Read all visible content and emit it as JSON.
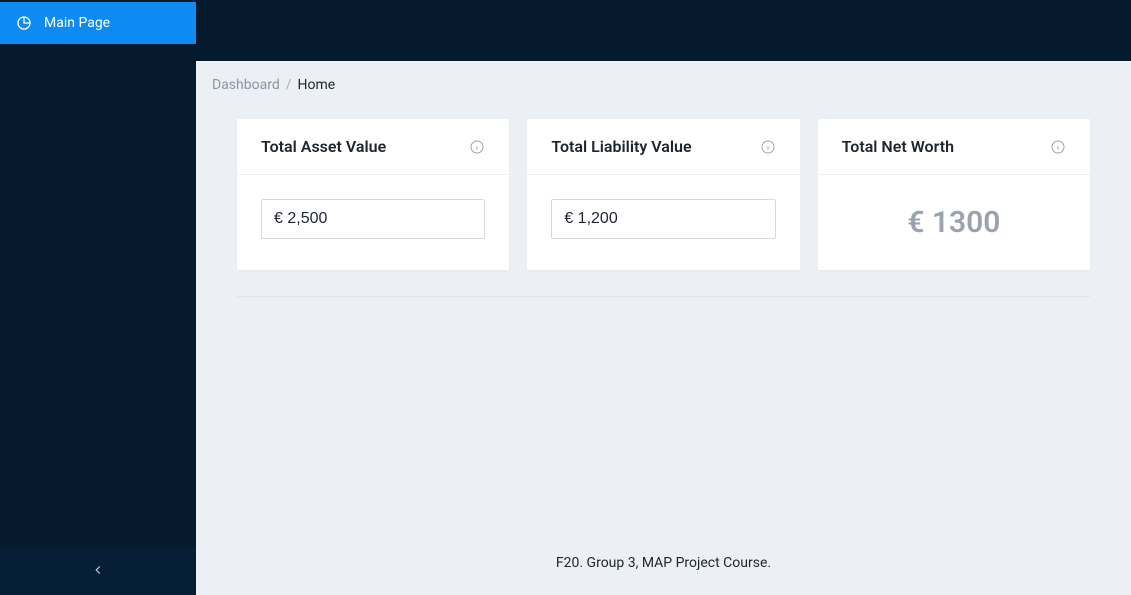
{
  "sidebar": {
    "main_page_label": "Main Page"
  },
  "breadcrumb": {
    "root": "Dashboard",
    "sep": "/",
    "current": "Home"
  },
  "cards": {
    "asset": {
      "title": "Total Asset Value",
      "value": "€ 2,500"
    },
    "liability": {
      "title": "Total Liability Value",
      "value": "€ 1,200"
    },
    "networth": {
      "title": "Total Net Worth",
      "value": "€ 1300"
    }
  },
  "footer": {
    "text": "F20. Group 3, MAP Project Course."
  }
}
